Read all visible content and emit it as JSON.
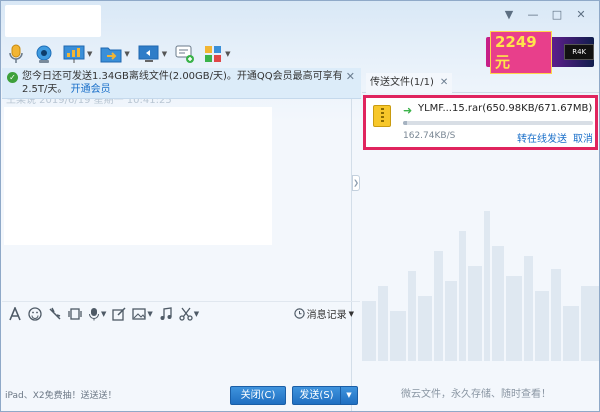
{
  "window": {
    "controls": [
      "▼",
      "—",
      "□",
      "✕"
    ]
  },
  "ad": {
    "price": "2249元",
    "badge": "R4K"
  },
  "notice": {
    "text": "您今日还可发送1.34GB离线文件(2.00GB/天)。开通QQ会员最高可享有2.5T/天。",
    "link": "开通会员",
    "close": "✕"
  },
  "chat": {
    "faded_line": "王某说 2019/6/19 星期一 10:41:25"
  },
  "edit_toolbar": {
    "history_label": "消息记录"
  },
  "footer": {
    "promo_text": "iPad、X2免费抽！送送送！",
    "close_button": "关闭(C)",
    "send_button": "发送(S)"
  },
  "transfer_panel": {
    "tab_label": "传送文件(1/1)",
    "tab_close": "✕",
    "file": {
      "name": "YLMF...15.rar(650.98KB/671.67MB)",
      "speed": "162.74KB/S",
      "progress": 0.001,
      "action_online": "转在线发送",
      "action_cancel": "取消"
    },
    "footer_text": "微云文件，永久存储、随时查看！"
  }
}
